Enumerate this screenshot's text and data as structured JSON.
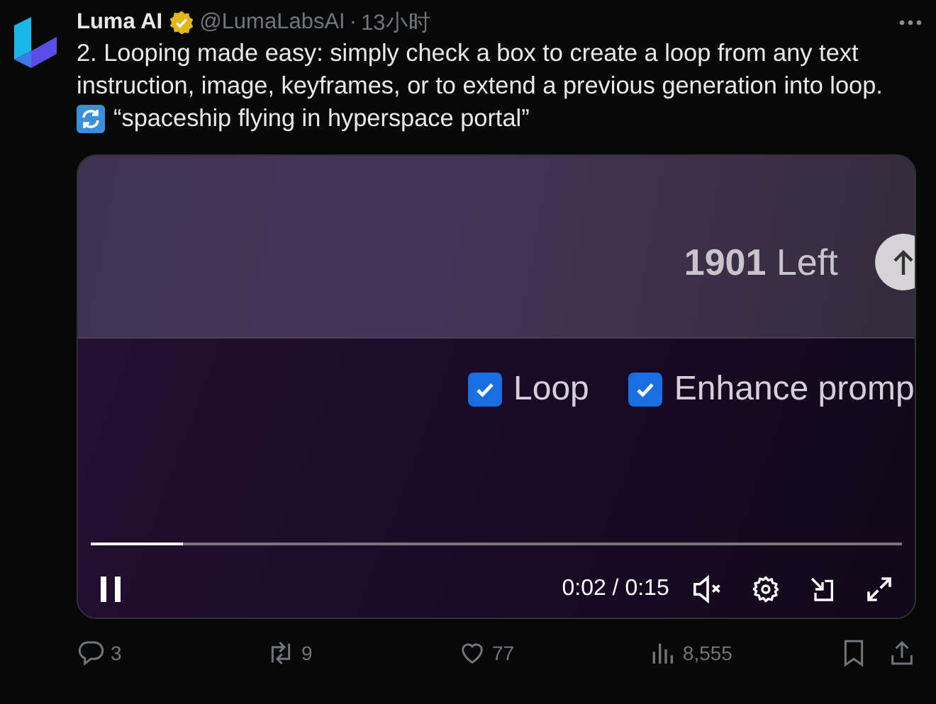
{
  "post": {
    "author": "Luma AI",
    "verified": true,
    "handle": "@LumaLabsAI",
    "separator": "·",
    "time": "13小时",
    "lines": [
      "2. Looping made easy: simply check a box to create a loop from any text",
      "instruction, image, keyframes, or to extend a previous generation into loop."
    ],
    "quote": "“spaceship flying in hyperspace portal”"
  },
  "video": {
    "credits": "1901",
    "credits_label": "Left",
    "options": [
      {
        "label": "Loop",
        "checked": true
      },
      {
        "label": "Enhance promp",
        "checked": true
      }
    ],
    "progress": {
      "level": 0.113
    },
    "playing": true,
    "time": "0:02 / 0:15",
    "muted": true
  },
  "actions": [
    {
      "kind": "reply",
      "count": "3"
    },
    {
      "kind": "repost",
      "count": "9"
    },
    {
      "kind": "like",
      "count": "77"
    },
    {
      "kind": "views",
      "count": "8,555"
    }
  ]
}
